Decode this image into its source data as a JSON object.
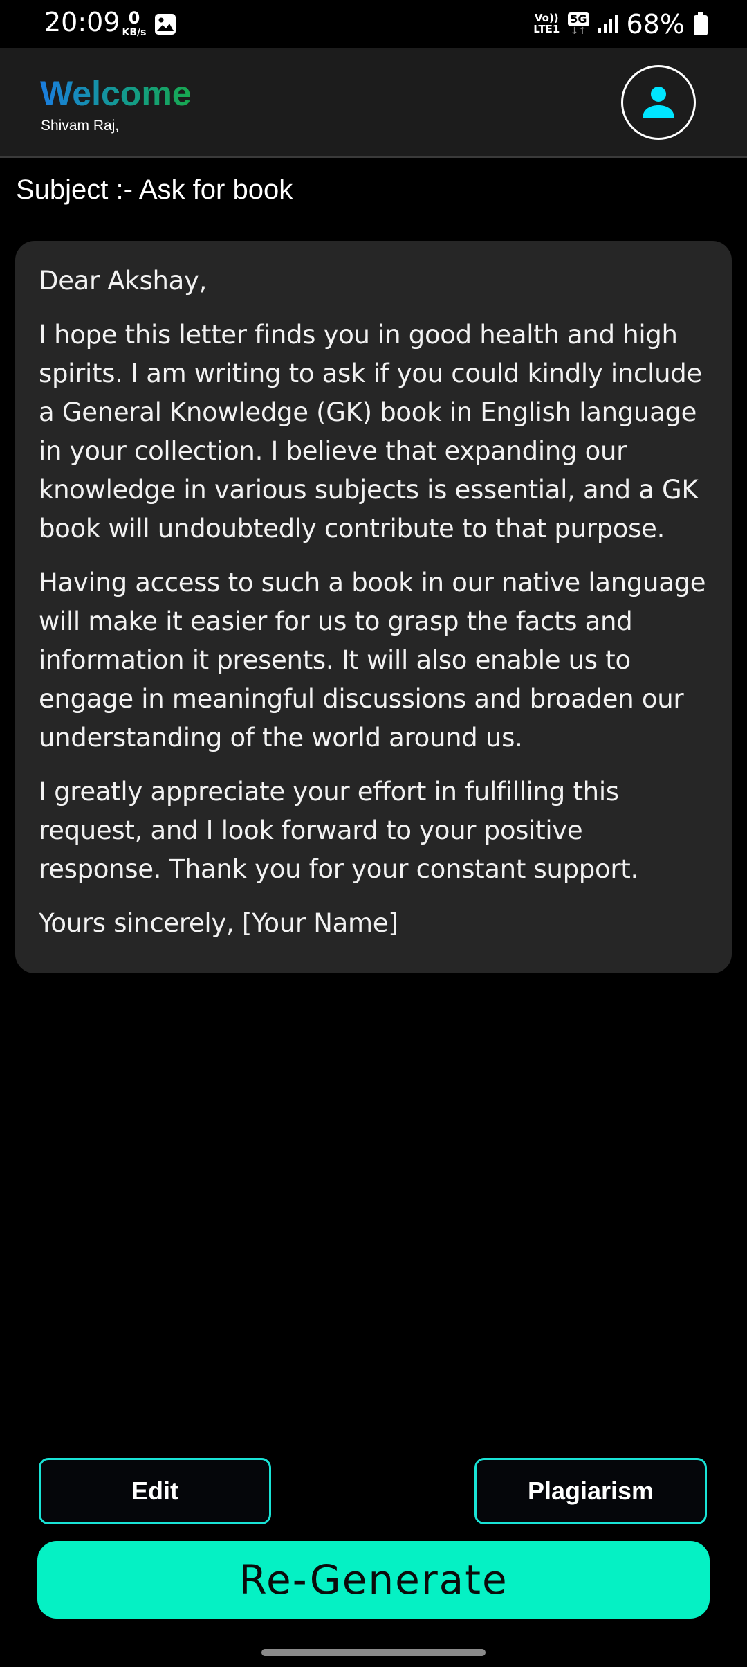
{
  "status_bar": {
    "time": "20:09",
    "net_speed_value": "0",
    "net_speed_unit": "KB/s",
    "volte_line1": "Vo))",
    "volte_line2": "LTE1",
    "network": "5G",
    "network_arrows": "↓↑",
    "battery": "68%"
  },
  "header": {
    "welcome": "Welcome",
    "user_name": "Shivam Raj,"
  },
  "subject": "Subject :- Ask for book",
  "letter": {
    "salutation": "Dear Akshay,",
    "paragraphs": [
      "I hope this letter finds you in good health and high spirits. I am writing to ask if you could kindly include a General Knowledge (GK) book in English language in your collection. I believe that expanding our knowledge in various subjects is essential, and a GK book will undoubtedly contribute to that purpose.",
      "Having access to such a book in our native language will make it easier for us to grasp the facts and information it presents. It will also enable us to engage in meaningful discussions and broaden our understanding of the world around us.",
      "I greatly appreciate your effort in fulfilling this request, and I look forward to your positive response. Thank you for your constant support."
    ],
    "closing": "Yours sincerely, [Your Name]"
  },
  "actions": {
    "edit_label": "Edit",
    "plagiarism_label": "Plagiarism",
    "regenerate_label": "Re-Generate"
  },
  "icons": {
    "profile": "person-icon",
    "gallery": "image-icon",
    "signal": "signal-icon",
    "battery": "battery-icon"
  },
  "colors": {
    "accent": "#05f1c4",
    "outline": "#19e3d6",
    "profile_icon": "#00e5ff",
    "card_bg": "#262626",
    "header_bg": "#1c1c1c"
  }
}
